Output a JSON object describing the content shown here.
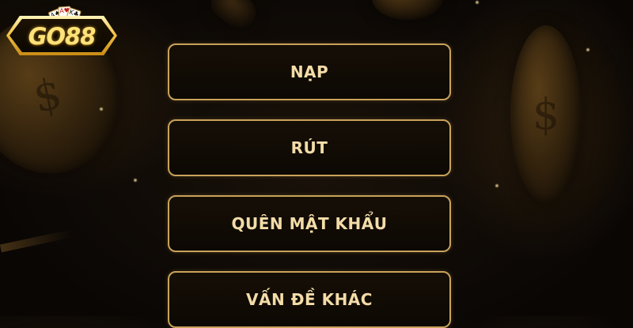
{
  "logo": {
    "text": "GO88",
    "cards": [
      "A♠",
      "A♥",
      "K♣"
    ]
  },
  "menu": {
    "items": [
      {
        "label": "NẠP"
      },
      {
        "label": "RÚT"
      },
      {
        "label": "QUÊN MẬT KHẨU"
      },
      {
        "label": "VẤN ĐỀ KHÁC"
      }
    ]
  },
  "background_icons": [
    "dollar-coin-icon",
    "dollar-coin-icon"
  ],
  "colors": {
    "background": "#0a0705",
    "button_border": "#c9a25a",
    "button_text": "#f3dca8",
    "logo_gold": "#f2c548"
  }
}
